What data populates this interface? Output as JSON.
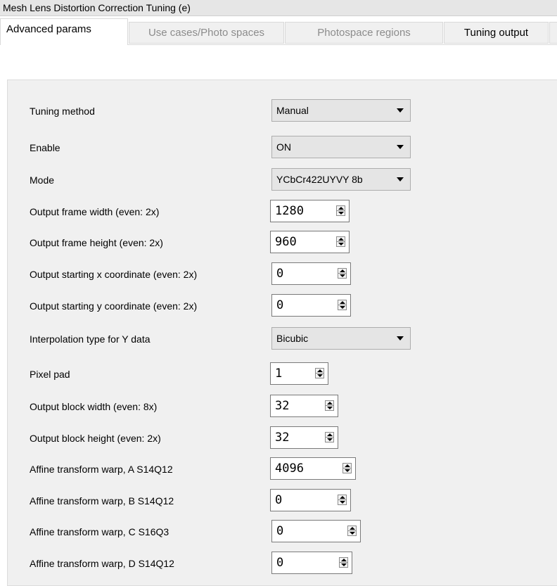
{
  "window": {
    "title": "Mesh Lens Distortion Correction Tuning (e)"
  },
  "tabs": [
    {
      "label": "Advanced params"
    },
    {
      "label": "Use cases/Photo spaces"
    },
    {
      "label": "Photospace regions"
    },
    {
      "label": "Tuning output"
    }
  ],
  "rows": [
    {
      "label": "Tuning method",
      "control": "combo",
      "value": "Manual"
    },
    {
      "label": "Enable",
      "control": "combo",
      "value": "ON"
    },
    {
      "label": "Mode",
      "control": "combo",
      "value": "YCbCr422UYVY 8b"
    },
    {
      "label": "Output frame width (even: 2x)",
      "control": "spin",
      "value": "1280"
    },
    {
      "label": "Output frame height (even: 2x)",
      "control": "spin",
      "value": "960"
    },
    {
      "label": "Output starting x coordinate (even: 2x)",
      "control": "spin",
      "value": "0"
    },
    {
      "label": "Output starting y coordinate (even: 2x)",
      "control": "spin",
      "value": "0"
    },
    {
      "label": "Interpolation type for Y data",
      "control": "combo",
      "value": "Bicubic"
    },
    {
      "label": "Pixel pad",
      "control": "spin",
      "value": "1"
    },
    {
      "label": "Output block width (even: 8x)",
      "control": "spin",
      "value": "32"
    },
    {
      "label": "Output block height (even: 2x)",
      "control": "spin",
      "value": "32"
    },
    {
      "label": "Affine transform warp, A S14Q12",
      "control": "spin",
      "value": "4096"
    },
    {
      "label": "Affine transform warp, B S14Q12",
      "control": "spin",
      "value": "0"
    },
    {
      "label": "Affine transform warp, C S16Q3",
      "control": "spin",
      "value": "0"
    },
    {
      "label": "Affine transform warp, D S14Q12",
      "control": "spin",
      "value": "0"
    }
  ]
}
